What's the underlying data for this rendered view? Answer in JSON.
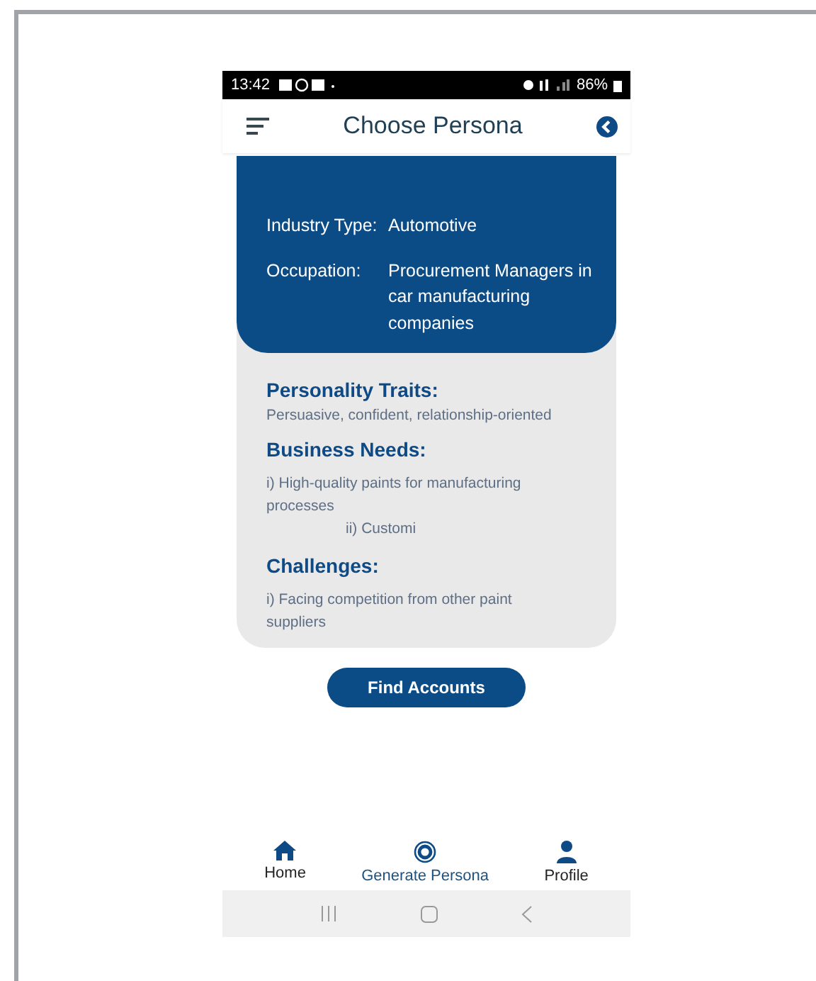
{
  "status_bar": {
    "time": "13:42",
    "battery": "86%"
  },
  "header": {
    "title": "Choose Persona"
  },
  "persona": {
    "fields": [
      {
        "label": "Industry Type:",
        "value": "Automotive"
      },
      {
        "label": "Occupation:",
        "value": "Procurement Managers in car manufacturing companies"
      }
    ],
    "sections": [
      {
        "heading": "Personality Traits:",
        "lines": [
          "Persuasive, confident, relationship-oriented"
        ]
      },
      {
        "heading": "Business Needs:",
        "lines": [
          "i) High-quality paints for manufacturing processes",
          "ii) Customi"
        ]
      },
      {
        "heading": "Challenges:",
        "lines": [
          "i) Facing competition from other paint suppliers"
        ]
      }
    ]
  },
  "action_button": "Find Accounts",
  "bottom_nav": [
    {
      "label": "Home",
      "kind": "home",
      "selected": false
    },
    {
      "label": "Generate Persona",
      "kind": "generate",
      "selected": true
    },
    {
      "label": "Profile",
      "kind": "profile",
      "selected": false
    }
  ]
}
